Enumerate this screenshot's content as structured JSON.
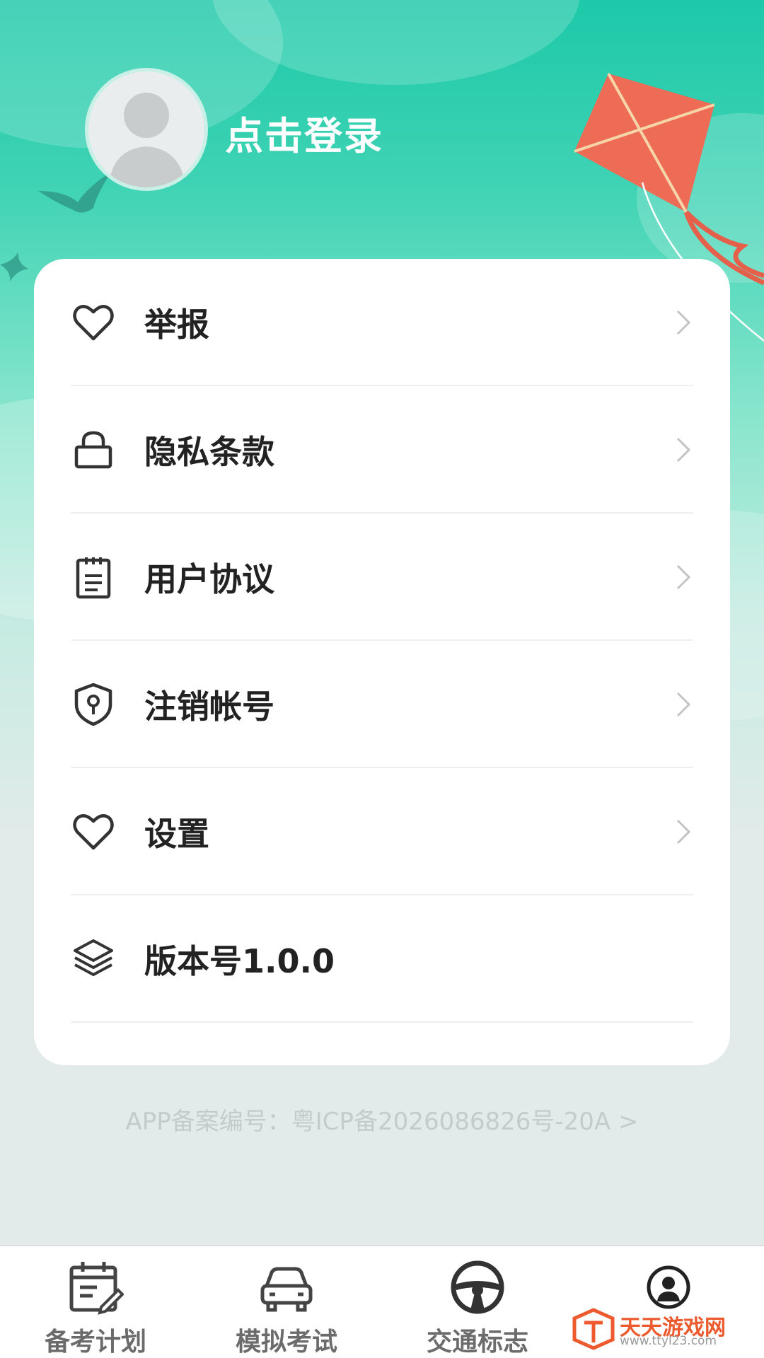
{
  "profile": {
    "login_label": "点击登录"
  },
  "menu": [
    {
      "label": "举报",
      "icon": "heart-icon"
    },
    {
      "label": "隐私条款",
      "icon": "lock-icon"
    },
    {
      "label": "用户协议",
      "icon": "document-icon"
    },
    {
      "label": "注销帐号",
      "icon": "shield-keyhole-icon"
    },
    {
      "label": "设置",
      "icon": "heart-icon"
    },
    {
      "label": "版本号1.0.0",
      "icon": "layers-icon"
    }
  ],
  "icp": {
    "text": "APP备案编号：粤ICP备2026086826号-20A >"
  },
  "tabs": [
    {
      "label": "备考计划",
      "icon": "calendar-edit-icon"
    },
    {
      "label": "模拟考试",
      "icon": "car-icon"
    },
    {
      "label": "交通标志",
      "icon": "steering-wheel-icon"
    },
    {
      "label": "",
      "icon": "profile-icon"
    }
  ],
  "watermark": {
    "name": "天天游戏网",
    "url": "www.ttyl23.com"
  },
  "colors": {
    "accent": "#1dc9a9",
    "text": "#222222",
    "tab_text": "#6b6b6b"
  }
}
